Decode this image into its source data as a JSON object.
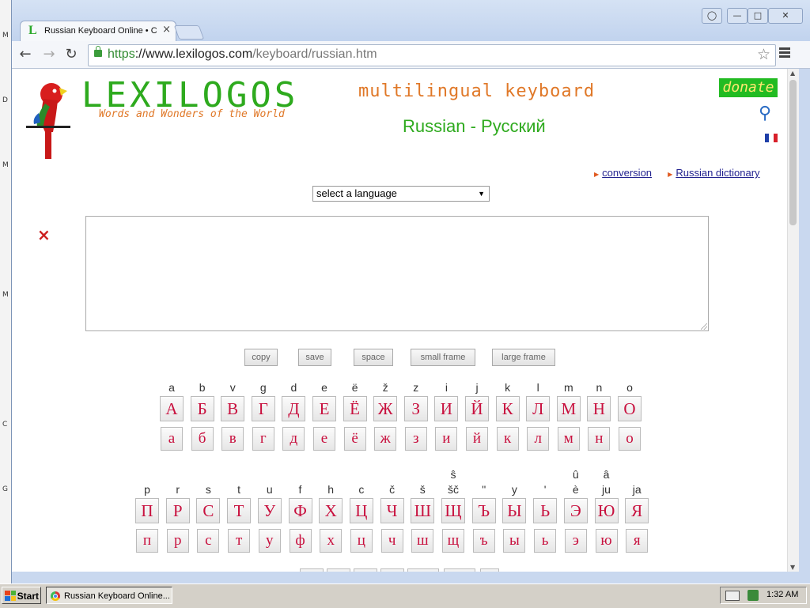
{
  "browser": {
    "tab_title": "Russian Keyboard Online • C",
    "tab_close": "×",
    "url_scheme": "https",
    "url_host": "://www.lexilogos.com",
    "url_path": "/keyboard/russian.htm"
  },
  "desktop_icons": [
    "M",
    "D",
    "M",
    "M",
    "C",
    "G"
  ],
  "site": {
    "logo": "LEXILOGOS",
    "tagline": "Words and Wonders of the World",
    "heading": "multilingual keyboard",
    "subtitle": "Russian - Русский",
    "donate": "donate",
    "links": [
      "conversion",
      "Russian dictionary"
    ],
    "language_select": "select a language",
    "clear_icon": "×"
  },
  "buttons": [
    "copy",
    "save",
    "space",
    "small frame",
    "large frame"
  ],
  "keyboard": {
    "row1": {
      "latin": [
        "a",
        "b",
        "v",
        "g",
        "d",
        "e",
        "ë",
        "ž",
        "z",
        "i",
        "j",
        "k",
        "l",
        "m",
        "n",
        "o"
      ],
      "upper": [
        "А",
        "Б",
        "В",
        "Г",
        "Д",
        "Е",
        "Ё",
        "Ж",
        "З",
        "И",
        "Й",
        "К",
        "Л",
        "М",
        "Н",
        "О"
      ],
      "lower": [
        "а",
        "б",
        "в",
        "г",
        "д",
        "е",
        "ё",
        "ж",
        "з",
        "и",
        "й",
        "к",
        "л",
        "м",
        "н",
        "о"
      ]
    },
    "row2": {
      "latin_top": [
        "",
        "",
        "",
        "",
        "",
        "",
        "",
        "",
        "",
        "",
        "ŝ",
        "",
        "",
        "",
        "û",
        "â"
      ],
      "latin": [
        "p",
        "r",
        "s",
        "t",
        "u",
        "f",
        "h",
        "c",
        "č",
        "š",
        "šč",
        "ʺ",
        "y",
        "ʹ",
        "è",
        "ju",
        "ja"
      ],
      "upper": [
        "П",
        "Р",
        "С",
        "Т",
        "У",
        "Ф",
        "Х",
        "Ц",
        "Ч",
        "Ш",
        "Щ",
        "Ъ",
        "Ы",
        "Ь",
        "Э",
        "Ю",
        "Я"
      ],
      "lower": [
        "п",
        "р",
        "с",
        "т",
        "у",
        "ф",
        "х",
        "ц",
        "ч",
        "ш",
        "щ",
        "ъ",
        "ы",
        "ь",
        "э",
        "ю",
        "я"
      ]
    }
  },
  "taskbar": {
    "start": "Start",
    "task": "Russian Keyboard Online...",
    "clock": "1:32 AM"
  },
  "colors": {
    "logo_green": "#2eaa1e",
    "accent_orange": "#e07828",
    "key_red": "#c8103e",
    "donate_bg": "#22bb22"
  }
}
